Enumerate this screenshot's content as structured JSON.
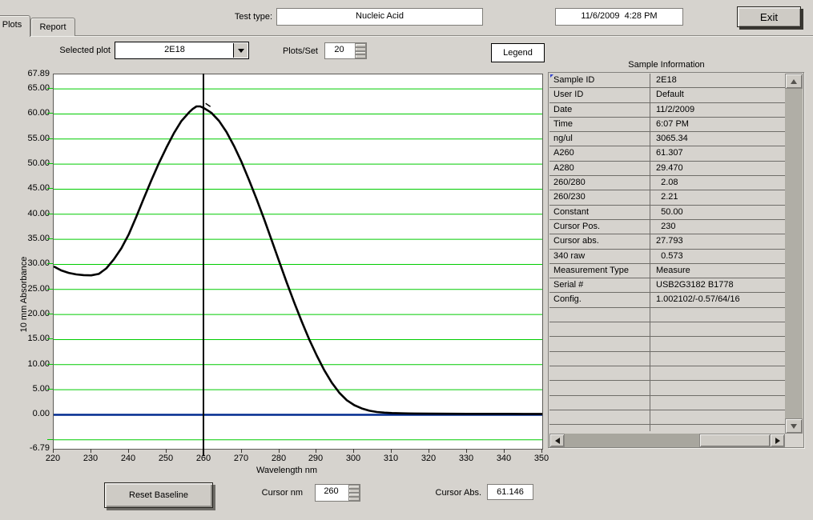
{
  "tabs": [
    {
      "label": "Plots",
      "active": true
    },
    {
      "label": "Report",
      "active": false
    }
  ],
  "header": {
    "test_type_label": "Test type:",
    "test_type_value": "Nucleic Acid",
    "datetime_value": "11/6/2009  4:28 PM",
    "exit_label": "Exit"
  },
  "toolbar": {
    "selected_plot_label": "Selected plot",
    "selected_plot_value": "2E18",
    "plots_per_set_label": "Plots/Set",
    "plots_per_set_value": "20",
    "legend_label": "Legend"
  },
  "chart_data": {
    "type": "line",
    "title": "",
    "xlabel": "Wavelength nm",
    "ylabel": "10 mm Absorbance",
    "xlim": [
      220,
      350
    ],
    "ylim": [
      -6.79,
      67.89
    ],
    "x_ticks": [
      220,
      230,
      240,
      250,
      260,
      270,
      280,
      290,
      300,
      310,
      320,
      330,
      340,
      350
    ],
    "y_tick_labels": [
      "67.89",
      "65.00",
      "60.00",
      "55.00",
      "50.00",
      "45.00",
      "40.00",
      "35.00",
      "30.00",
      "25.00",
      "20.00",
      "15.00",
      "10.00",
      "5.00",
      "0.00",
      "-6.79"
    ],
    "y_gridlines": [
      65,
      60,
      55,
      50,
      45,
      40,
      35,
      30,
      25,
      20,
      15,
      10,
      5,
      -5
    ],
    "grid_on": true,
    "grid_color": "#00cc00",
    "baseline_value": 0.0,
    "baseline_color": "#002a8f",
    "curve_color": "#000000",
    "cursor_x": 260,
    "cursor_y": 61.146,
    "legend_position": "none",
    "series": [
      {
        "name": "2E18",
        "x": [
          220,
          222,
          224,
          226,
          228,
          230,
          232,
          234,
          236,
          238,
          240,
          242,
          244,
          246,
          248,
          250,
          252,
          254,
          256,
          257,
          258,
          259,
          260,
          261,
          262,
          264,
          266,
          268,
          270,
          272,
          274,
          276,
          278,
          280,
          282,
          284,
          286,
          288,
          290,
          292,
          294,
          296,
          298,
          300,
          302,
          304,
          306,
          308,
          310,
          313,
          316,
          320,
          325,
          330,
          335,
          340,
          345,
          350
        ],
        "y": [
          29.6,
          28.8,
          28.3,
          28.0,
          27.85,
          27.8,
          28.1,
          29.2,
          31.0,
          33.2,
          36.0,
          39.5,
          43.2,
          46.8,
          50.2,
          53.3,
          56.2,
          58.6,
          60.3,
          61.0,
          61.5,
          61.5,
          61.15,
          60.7,
          60.2,
          58.6,
          56.4,
          53.6,
          50.4,
          46.8,
          43.0,
          39.0,
          34.8,
          30.6,
          26.4,
          22.4,
          18.6,
          15.0,
          11.8,
          8.9,
          6.4,
          4.4,
          2.9,
          1.9,
          1.25,
          0.8,
          0.55,
          0.42,
          0.35,
          0.28,
          0.25,
          0.22,
          0.2,
          0.19,
          0.18,
          0.18,
          0.17,
          0.16
        ]
      }
    ]
  },
  "sample_info": {
    "title": "Sample Information",
    "rows": [
      {
        "label": "Sample ID",
        "value": "2E18"
      },
      {
        "label": "User ID",
        "value": "Default"
      },
      {
        "label": "Date",
        "value": "11/2/2009"
      },
      {
        "label": "Time",
        "value": "6:07 PM"
      },
      {
        "label": "ng/ul",
        "value": "3065.34"
      },
      {
        "label": "A260",
        "value": "61.307"
      },
      {
        "label": "A280",
        "value": "29.470"
      },
      {
        "label": "260/280",
        "value": "  2.08"
      },
      {
        "label": "260/230",
        "value": "  2.21"
      },
      {
        "label": "Constant",
        "value": "  50.00"
      },
      {
        "label": "Cursor Pos.",
        "value": "  230"
      },
      {
        "label": "Cursor abs.",
        "value": "27.793"
      },
      {
        "label": "340 raw",
        "value": "  0.573"
      },
      {
        "label": "Measurement Type",
        "value": "Measure"
      },
      {
        "label": "Serial #",
        "value": "USB2G3182 B1778"
      },
      {
        "label": "Config.",
        "value": "1.002102/-0.57/64/16"
      }
    ],
    "empty_row_count": 9
  },
  "footer": {
    "reset_baseline_label": "Reset Baseline",
    "cursor_nm_label": "Cursor nm",
    "cursor_nm_value": "260",
    "cursor_abs_label": "Cursor Abs.",
    "cursor_abs_value": "61.146"
  }
}
